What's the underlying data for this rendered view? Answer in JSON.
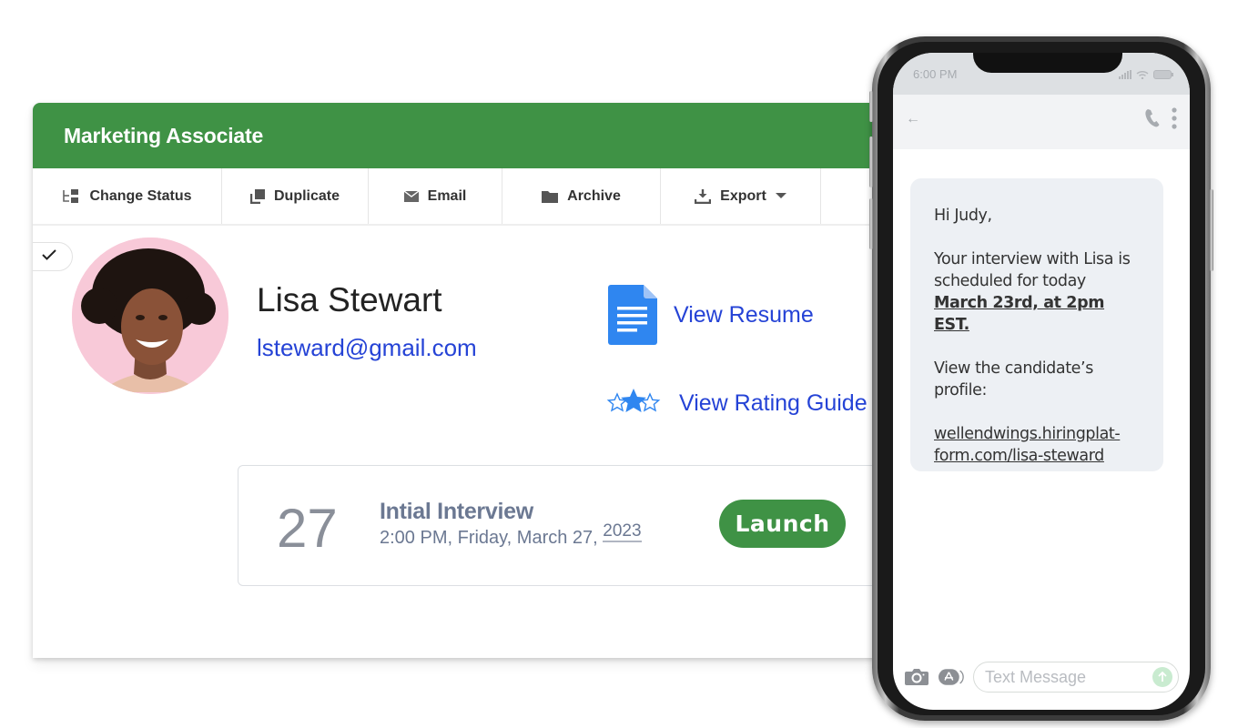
{
  "job": {
    "title": "Marketing Associate",
    "header_color": "#3f9245"
  },
  "toolbar": {
    "items": [
      {
        "label": "Change Status",
        "icon": "change-status-icon"
      },
      {
        "label": "Duplicate",
        "icon": "duplicate-icon"
      },
      {
        "label": "Email",
        "icon": "envelope-icon"
      },
      {
        "label": "Archive",
        "icon": "folder-icon"
      },
      {
        "label": "Export",
        "icon": "download-icon",
        "dropdown": true
      }
    ]
  },
  "candidate": {
    "name": "Lisa Stewart",
    "email": "lsteward@gmail.com",
    "selected": true,
    "links": {
      "resume": "View Resume",
      "rating_guide": "View Rating Guide"
    }
  },
  "interview": {
    "day": "27",
    "title": "Intial Interview",
    "datetime": "2:00 PM, Friday, March 27,",
    "year": "2023",
    "launch_label": "Launch"
  },
  "phone": {
    "status_time": "6:00 PM",
    "message": {
      "greeting": "Hi Judy,",
      "line1": "Your interview with Lisa is scheduled for today ",
      "highlight": "March 23rd, at 2pm EST.",
      "line2": "View the candidate’s profile:",
      "link": "wellendwings.hiringplat-form.com/lisa-steward"
    },
    "composer_placeholder": "Text Message"
  },
  "colors": {
    "accent_green": "#3f9245",
    "link_blue": "#2543d6",
    "muted_slate": "#6b7892"
  }
}
